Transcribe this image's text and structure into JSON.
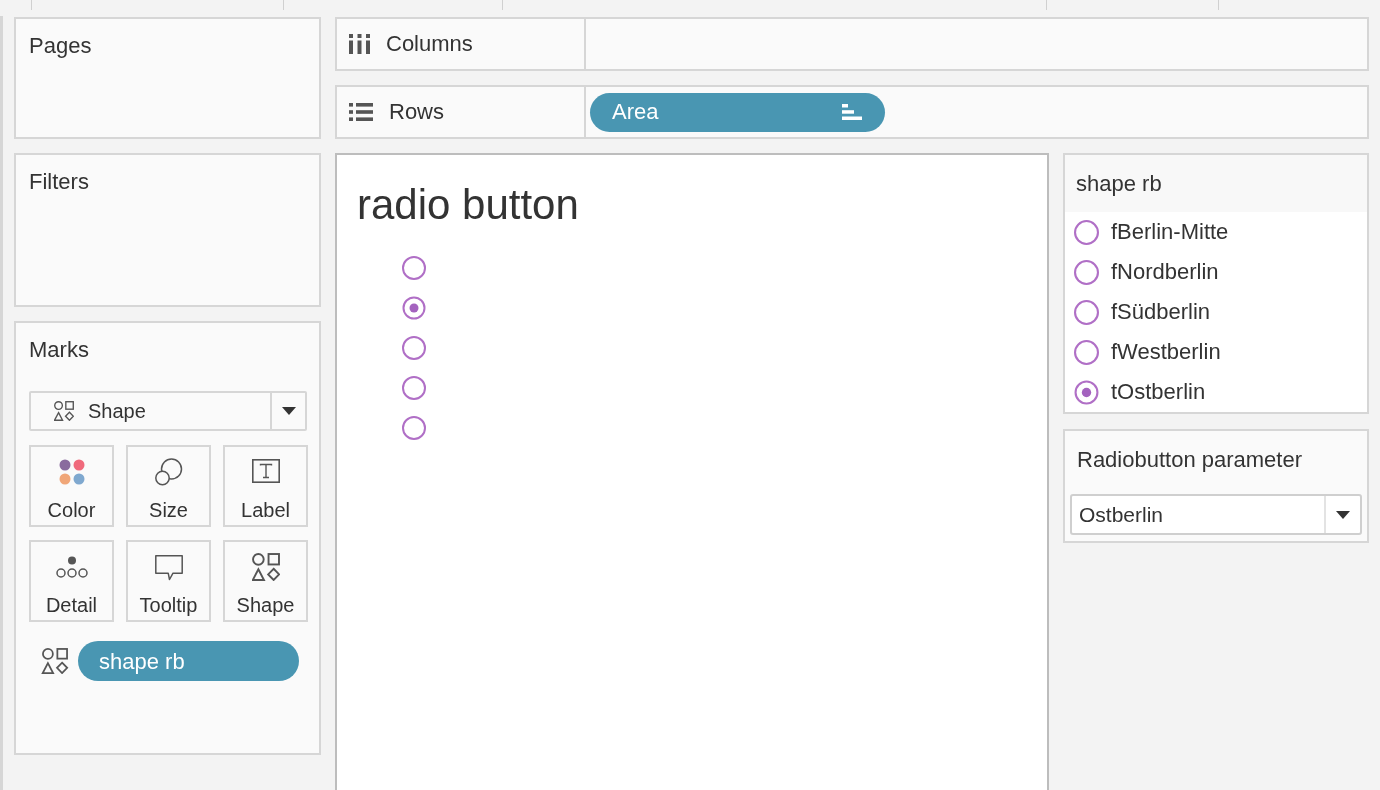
{
  "cards": [
    {
      "title": "Pages"
    },
    {
      "title": "Filters"
    }
  ],
  "marks_card": {
    "title": "Marks",
    "mark_type": "Shape",
    "buttons": [
      {
        "label": "Color",
        "kind": "color"
      },
      {
        "label": "Size",
        "kind": "size"
      },
      {
        "label": "Label",
        "kind": "label"
      },
      {
        "label": "Detail",
        "kind": "detail"
      },
      {
        "label": "Tooltip",
        "kind": "tooltip"
      },
      {
        "label": "Shape",
        "kind": "shape"
      }
    ],
    "fields": [
      {
        "label": "shape rb",
        "kind": "shape"
      }
    ]
  },
  "shelves": [
    {
      "label": "Columns",
      "kind": "columns"
    },
    {
      "label": "Rows",
      "kind": "rows",
      "pills": [
        {
          "label": "Area"
        }
      ]
    }
  ],
  "view": {
    "title": "radio button",
    "marks": [
      {
        "selected": false
      },
      {
        "selected": true
      },
      {
        "selected": false
      },
      {
        "selected": false
      },
      {
        "selected": false
      }
    ]
  },
  "legend": {
    "title": "shape rb",
    "items": [
      {
        "label": "fBerlin-Mitte",
        "selected": false
      },
      {
        "label": "fNordberlin",
        "selected": false
      },
      {
        "label": "fSüdberlin",
        "selected": false
      },
      {
        "label": "fWestberlin",
        "selected": false
      },
      {
        "label": "tOstberlin",
        "selected": true
      }
    ]
  },
  "parameter": {
    "title": "Radiobutton parameter",
    "value": "Ostberlin"
  }
}
